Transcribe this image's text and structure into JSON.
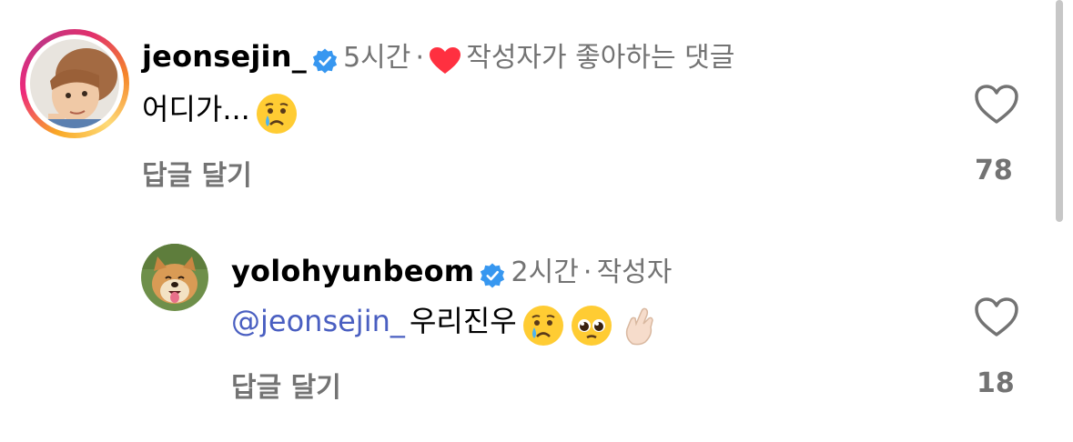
{
  "comments": [
    {
      "username": "jeonsejin_",
      "time": "5시간",
      "separator": "·",
      "liked_by_author": "작성자가 좋아하는 댓글",
      "text": "어디가...",
      "reply_label": "답글 달기",
      "like_count": "78"
    },
    {
      "username": "yolohyunbeom",
      "time": "2시간",
      "separator": "·",
      "author_tag": "작성자",
      "mention": "@jeonsejin_",
      "text": "우리진우",
      "reply_label": "답글 달기",
      "like_count": "18"
    }
  ],
  "colors": {
    "verified": "#3797f0",
    "meta_gray": "#737373",
    "mention_blue": "#4a5fc1",
    "heart_red": "#ff3040"
  },
  "icons": [
    "verified-badge-icon",
    "red-heart-icon",
    "crying-face-emoji",
    "pleading-face-emoji",
    "finger-heart-emoji",
    "like-heart-icon"
  ]
}
